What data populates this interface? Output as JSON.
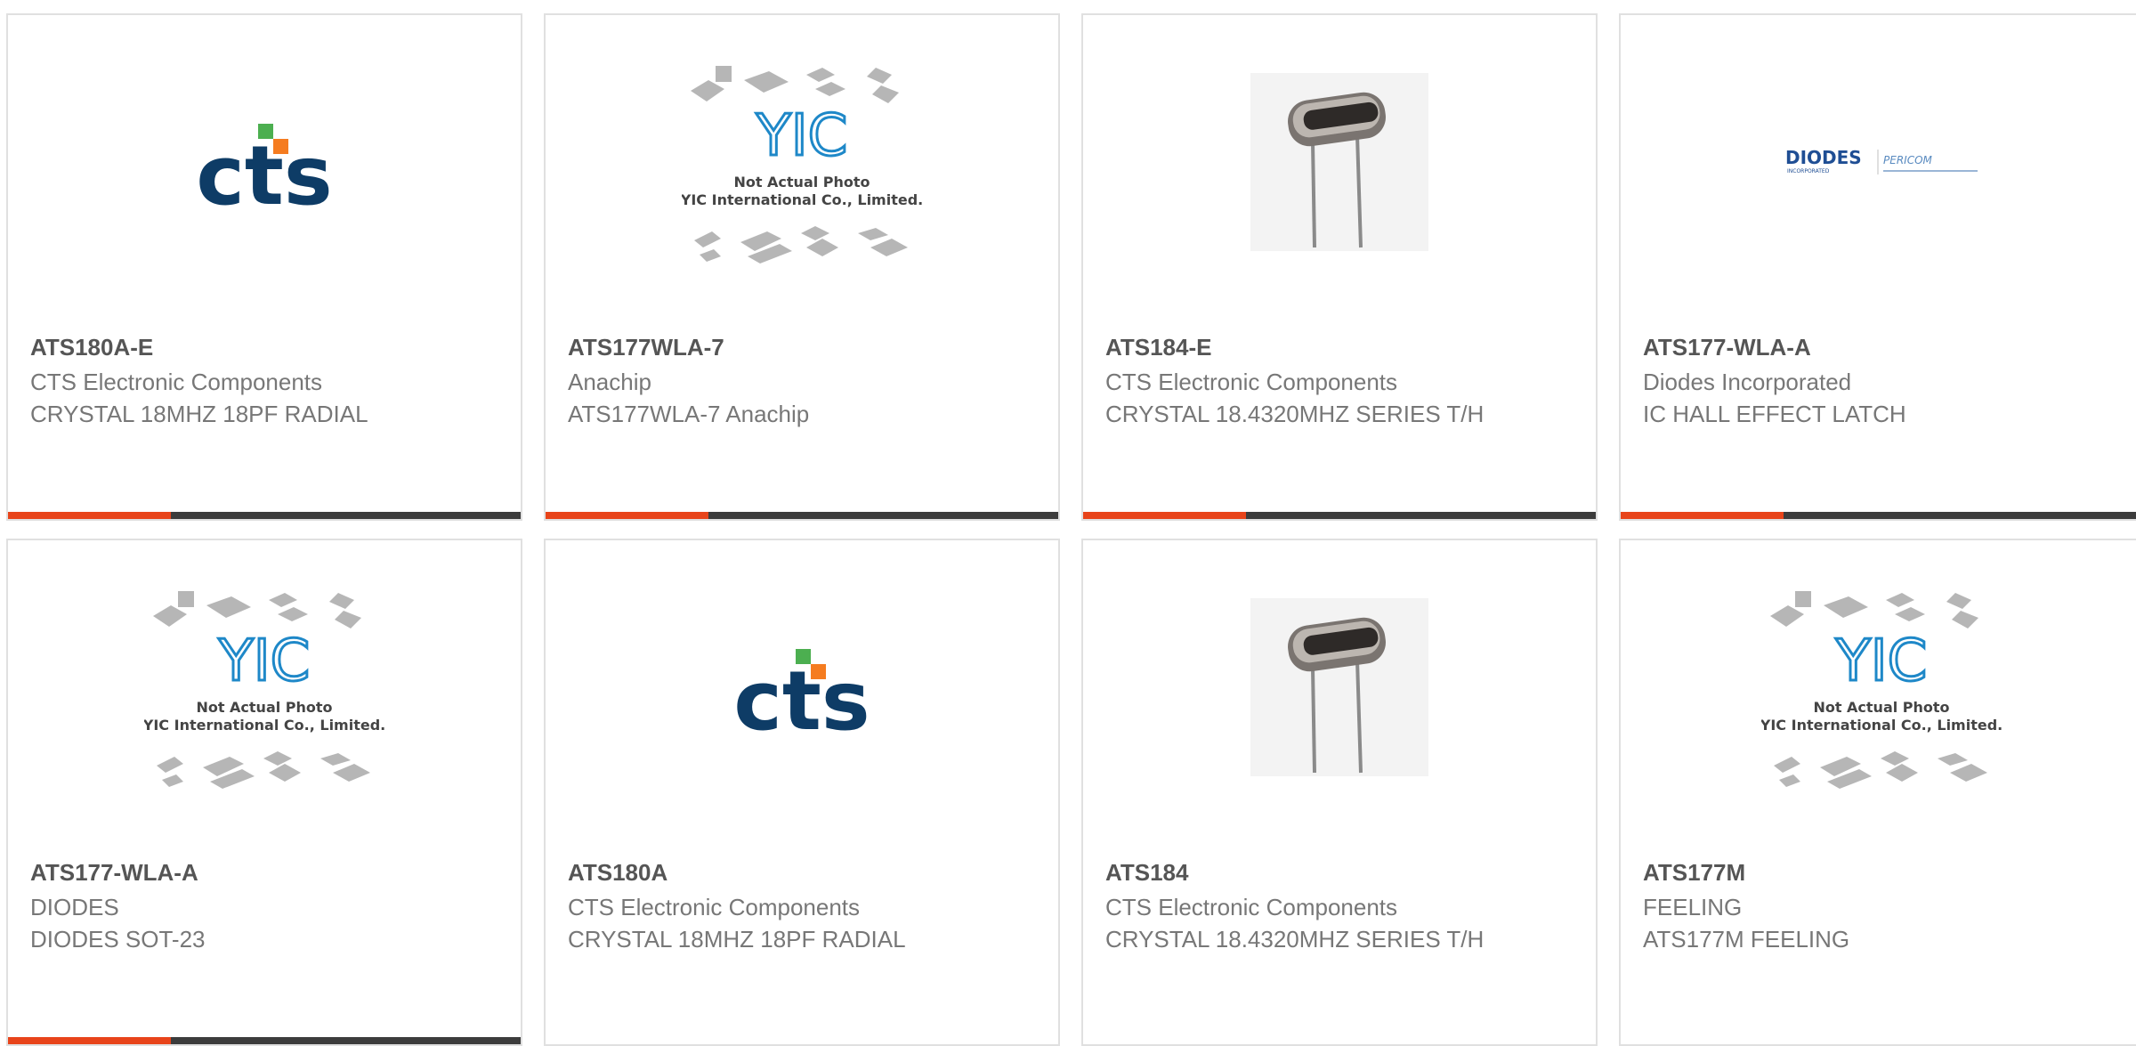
{
  "accent_color": "#e8441a",
  "bar_color": "#3c3c3c",
  "placeholder": {
    "brand": "YIC",
    "line1": "Not Actual Photo",
    "line2": "YIC International Co., Limited."
  },
  "logos": {
    "cts": "cts",
    "diodes": "DIODES",
    "diodes_sub": "INCORPORATED",
    "pericom": "PERICOM"
  },
  "products": [
    {
      "part": "ATS180A-E",
      "manufacturer": "CTS Electronic Components",
      "description": "CRYSTAL 18MHZ 18PF RADIAL",
      "image": "cts-logo"
    },
    {
      "part": "ATS177WLA-7",
      "manufacturer": "Anachip",
      "description": "ATS177WLA-7 Anachip",
      "image": "placeholder"
    },
    {
      "part": "ATS184-E",
      "manufacturer": "CTS Electronic Components",
      "description": "CRYSTAL 18.4320MHZ SERIES T/H",
      "image": "crystal-photo"
    },
    {
      "part": "ATS177-WLA-A",
      "manufacturer": "Diodes Incorporated",
      "description": "IC HALL EFFECT LATCH",
      "image": "diodes-logo"
    },
    {
      "part": "ATS177-WLA-A",
      "manufacturer": "DIODES",
      "description": "DIODES SOT-23",
      "image": "placeholder"
    },
    {
      "part": "ATS180A",
      "manufacturer": "CTS Electronic Components",
      "description": "CRYSTAL 18MHZ 18PF RADIAL",
      "image": "cts-logo"
    },
    {
      "part": "ATS184",
      "manufacturer": "CTS Electronic Components",
      "description": "CRYSTAL 18.4320MHZ SERIES T/H",
      "image": "crystal-photo"
    },
    {
      "part": "ATS177M",
      "manufacturer": "FEELING",
      "description": "ATS177M FEELING",
      "image": "placeholder"
    }
  ]
}
